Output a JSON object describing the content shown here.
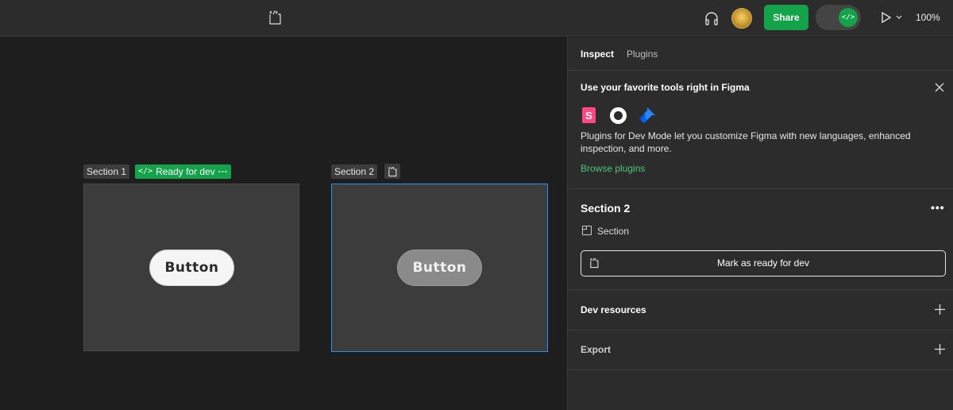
{
  "topbar": {
    "share_label": "Share",
    "zoom_label": "100%"
  },
  "canvas": {
    "section1_label": "Section 1",
    "ready_badge_label": "Ready for dev",
    "ready_badge_more": "···",
    "section2_label": "Section 2",
    "button1_label": "Button",
    "button2_label": "Button"
  },
  "panel": {
    "tabs": [
      {
        "label": "Inspect"
      },
      {
        "label": "Plugins"
      }
    ],
    "promo": {
      "title": "Use your favorite tools right in Figma",
      "body": "Plugins for Dev Mode let you customize Figma with new languages, enhanced inspection, and more.",
      "link": "Browse plugins"
    },
    "selection": {
      "title": "Section 2",
      "type_label": "Section",
      "mark_button": "Mark as ready for dev"
    },
    "dev_resources": "Dev resources",
    "export": "Export"
  },
  "colors": {
    "accent_green": "#14a34a",
    "link_green": "#4cc77a",
    "selection_blue": "#2b8ef0"
  }
}
